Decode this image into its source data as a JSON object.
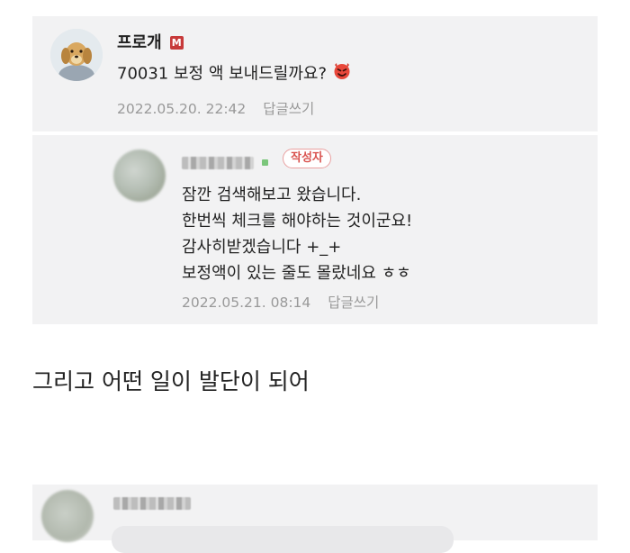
{
  "comments": [
    {
      "author": "프로개",
      "author_badge": "M",
      "text": "70031 보정 액 보내드릴까요?",
      "emoji_icon": "smiling-devil-icon",
      "date": "2022.05.20. 22:42",
      "reply_label": "답글쓰기"
    }
  ],
  "reply": {
    "author_badge": "작성자",
    "lines": [
      "잠깐 검색해보고 왔습니다.",
      "한번씩 체크를 해야하는 것이군요!",
      "감사히받겠습니다 +_+",
      "보정액이 있는 줄도 몰랐네요 ㅎㅎ"
    ],
    "date": "2022.05.21. 08:14",
    "reply_label": "답글쓰기"
  },
  "caption": "그리고 어떤 일이 발단이 되어",
  "colors": {
    "panel_bg": "#f2f2f3",
    "meta_text": "#999999",
    "writer_badge": "#d9534f",
    "m_badge": "#c73a3a"
  }
}
